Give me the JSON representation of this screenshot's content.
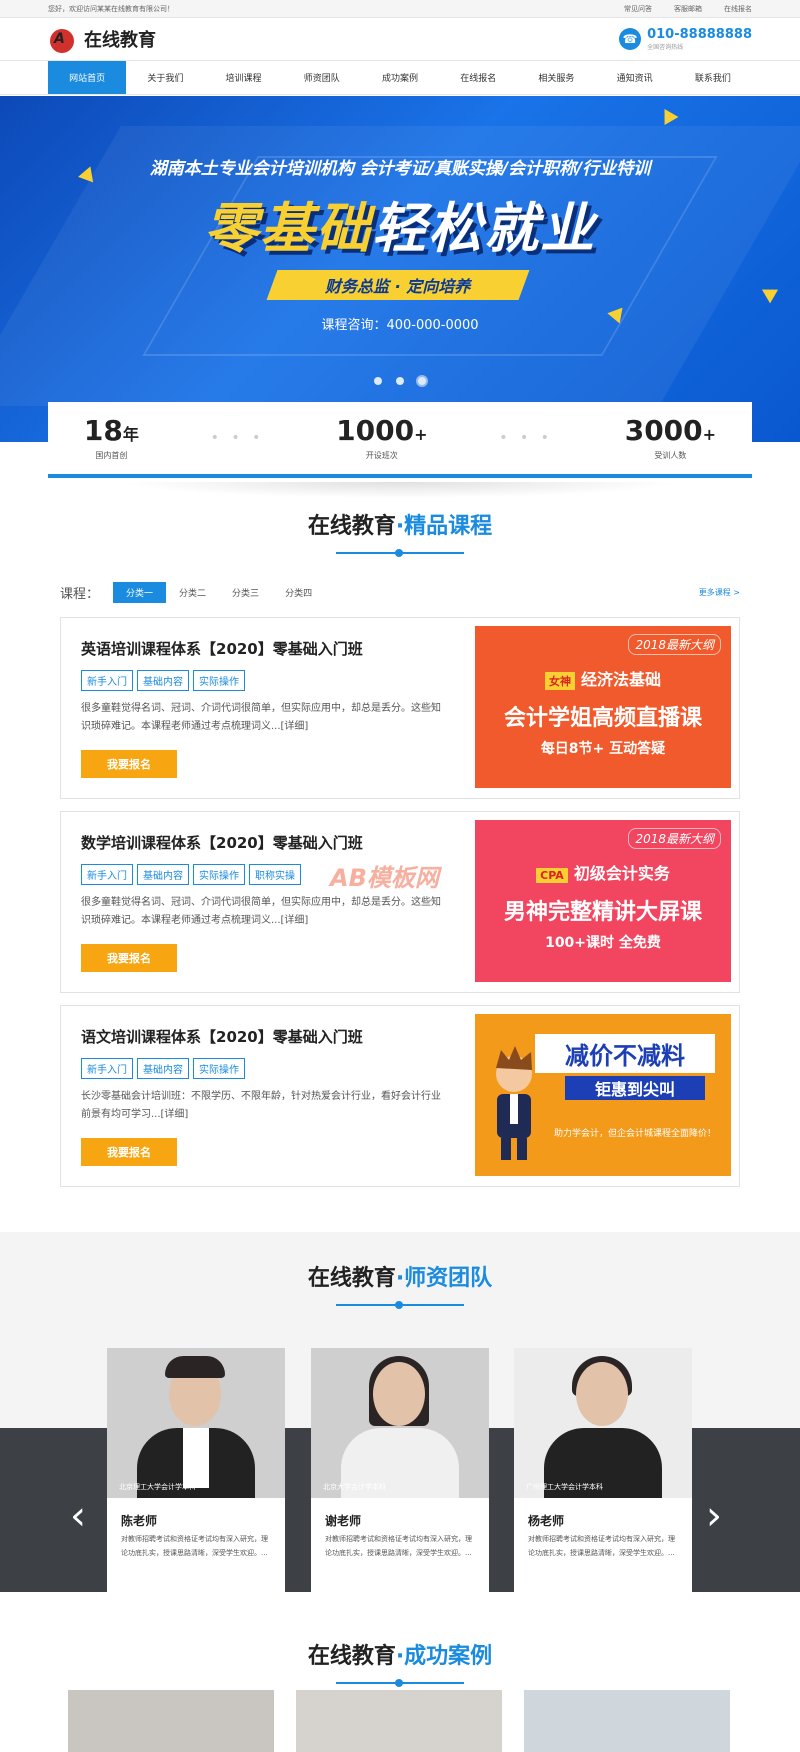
{
  "topbar": {
    "welcome": "您好，欢迎访问某某在线教育有限公司！",
    "links": [
      "常见问答",
      "客服邮箱",
      "在线报名"
    ]
  },
  "header": {
    "logo_glyph": "A",
    "logo_name": "在线教育",
    "phone_icon": "phone-icon",
    "phone": "010-88888888",
    "phone_sub": "全国咨询热线"
  },
  "nav": [
    "网站首页",
    "关于我们",
    "培训课程",
    "师资团队",
    "成功案例",
    "在线报名",
    "相关服务",
    "通知资讯",
    "联系我们"
  ],
  "banner": {
    "tagline": "湖南本土专业会计培训机构  会计考证/真账实操/会计职称/行业特训",
    "hero_a": "零基础",
    "hero_b": "轻松就业",
    "ribbon": "财务总监 · 定向培养",
    "consult": "课程咨询：400-000-0000",
    "slides": 3,
    "active_slide": 3
  },
  "stats": [
    {
      "value": "18",
      "unit": "年",
      "label": "国内首创"
    },
    {
      "value": "1000",
      "unit": "+",
      "label": "开设班次"
    },
    {
      "value": "3000",
      "unit": "+",
      "label": "受训人数"
    }
  ],
  "stat_sep": "• • •",
  "courses_section": {
    "title_a": "在线教育",
    "title_b": "·精品课程"
  },
  "filter": {
    "label": "课程：",
    "options": [
      "分类一",
      "分类二",
      "分类三",
      "分类四"
    ],
    "selected": "分类一",
    "more": "更多课程 >"
  },
  "courses": [
    {
      "title": "英语培训课程体系【2020】零基础入门班",
      "tags": [
        "新手入门",
        "基础内容",
        "实际操作"
      ],
      "desc": "很多童鞋觉得名词、冠词、介词代词很简单，但实际应用中，却总是丢分。这些知识琐碎难记。本课程老师通过考点梳理词义...[详细]",
      "button": "我要报名",
      "img": {
        "year": "2018最新大纲",
        "badge": "女神",
        "line1": "经济法基础",
        "line2": "会计学姐高频直播课",
        "line3": "每日8节+ 互动答疑"
      }
    },
    {
      "title": "数学培训课程体系【2020】零基础入门班",
      "tags": [
        "新手入门",
        "基础内容",
        "实际操作",
        "职称实操"
      ],
      "desc": "很多童鞋觉得名词、冠词、介词代词很简单，但实际应用中，却总是丢分。这些知识琐碎难记。本课程老师通过考点梳理词义...[详细]",
      "button": "我要报名",
      "img": {
        "year": "2018最新大纲",
        "badge": "CPA",
        "line1": "初级会计实务",
        "line2": "男神完整精讲大屏课",
        "line3": "100+课时 全免费"
      }
    },
    {
      "title": "语文培训课程体系【2020】零基础入门班",
      "tags": [
        "新手入门",
        "基础内容",
        "实际操作"
      ],
      "desc": "长沙零基础会计培训班：不限学历、不限年龄，针对热爱会计行业，看好会计行业前景有均可学习...[详细]",
      "button": "我要报名",
      "img": {
        "big": "减价不减料",
        "mid": "钜惠到尖叫",
        "low": "助力学会计，但企会计城课程全面降价！"
      }
    }
  ],
  "watermark": "AB模板网",
  "team_section": {
    "title_a": "在线教育",
    "title_b": "·师资团队"
  },
  "teachers": [
    {
      "school": "北京理工大学会计学本科",
      "name": "陈老师",
      "desc": "对教师招聘考试和资格证考试均有深入研究，理论功底扎实，授课思路清晰，深受学生欢迎。..."
    },
    {
      "school": "北京大学会计学本科",
      "name": "谢老师",
      "desc": "对教师招聘考试和资格证考试均有深入研究，理论功底扎实，授课思路清晰，深受学生欢迎。..."
    },
    {
      "school": "广州理工大学会计学本科",
      "name": "杨老师",
      "desc": "对教师招聘考试和资格证考试均有深入研究，理论功底扎实，授课思路清晰，深受学生欢迎。..."
    }
  ],
  "arrows": {
    "prev": "‹",
    "next": "›"
  },
  "cases_section": {
    "title_a": "在线教育",
    "title_b": "·成功案例"
  }
}
